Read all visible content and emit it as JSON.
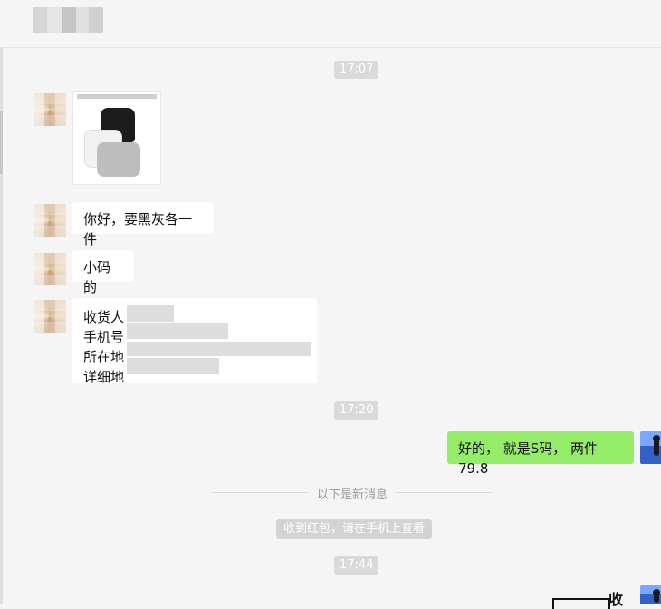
{
  "times": {
    "t1": "17:07",
    "t2": "17:20",
    "t3": "17:44"
  },
  "messages": {
    "m1": "你好，要黑灰各一件",
    "m2": "小码的",
    "m3": {
      "line1": "收货人",
      "line2": "手机号",
      "line3": "所在地",
      "line4": "详细地"
    },
    "m4": "好的， 就是S码， 两件79.8"
  },
  "system": {
    "new_messages": "以下是新消息",
    "red_packet_notice": "收到红包，请在手机上查看"
  },
  "bottom": {
    "partial_text": "收"
  },
  "colors": {
    "bg": "#f5f5f5",
    "bubble_white": "#ffffff",
    "bubble_green": "#95ec69",
    "time_badge": "#dadada"
  },
  "icons": {
    "avatar_contact": "blurred-avatar",
    "avatar_user": "user-avatar"
  }
}
